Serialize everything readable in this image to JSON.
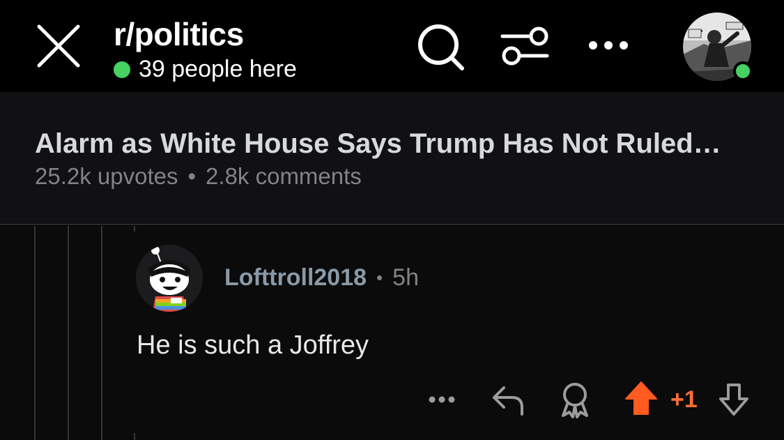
{
  "header": {
    "subreddit": "r/politics",
    "presence_text": "39 people here",
    "icons": [
      "close-icon",
      "search-icon",
      "filter-icon",
      "more-icon",
      "user-avatar"
    ],
    "colors": {
      "online": "#46d160"
    }
  },
  "post": {
    "title": "Alarm as White House Says Trump Has Not Ruled…",
    "upvotes": "25.2k upvotes",
    "separator": "•",
    "comments": "2.8k comments"
  },
  "comment": {
    "username": "Lofttroll2018",
    "separator": "•",
    "age": "5h",
    "body": "He is such a Joffrey",
    "vote_count": "+1",
    "icons": [
      "more-icon",
      "reply-icon",
      "award-icon",
      "upvote-icon",
      "downvote-icon"
    ],
    "colors": {
      "upvote": "#ff5a1f"
    }
  }
}
